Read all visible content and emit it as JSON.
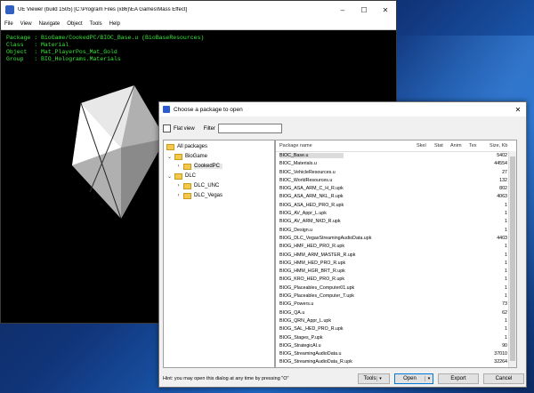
{
  "viewer": {
    "title": "UE Viewer (build 1505) [C:\\Program Files (x86)\\EA Games\\Mass Effect]",
    "menu": [
      "File",
      "View",
      "Navigate",
      "Object",
      "Tools",
      "Help"
    ],
    "console": [
      "Package : BioGame/CookedPC/BIOC_Base.u (BioBaseResources)",
      "Class   : Material",
      "Object  : Mat_PlayerPos_Mat_Gold",
      "Group   : BIO_Holograms.Materials"
    ]
  },
  "dialog": {
    "title": "Choose a package to open",
    "flat_view_label": "Flat view",
    "filter_label": "Filter",
    "filter_value": "",
    "tree": [
      {
        "label": "All packages",
        "icon": "folder-icon"
      },
      {
        "label": "BioGame",
        "icon": "folder-icon"
      },
      {
        "label": "CookedPC",
        "icon": "folder-icon"
      },
      {
        "label": "DLC",
        "icon": "folder-icon"
      },
      {
        "label": "DLC_UNC",
        "icon": "folder-icon"
      },
      {
        "label": "DLC_Vegas",
        "icon": "folder-icon"
      }
    ],
    "columns": [
      "Package name",
      "Skel",
      "Stat",
      "Anim",
      "Tex",
      "Size, Kb"
    ],
    "rows": [
      {
        "name": "BIOC_Base.u",
        "size": "5402"
      },
      {
        "name": "BIOC_Materials.u",
        "size": "44554"
      },
      {
        "name": "BIOC_VehicleResources.u",
        "size": "27"
      },
      {
        "name": "BIOC_WorldResources.u",
        "size": "132"
      },
      {
        "name": "BIOG_ASA_ARM_C_H_R.upk",
        "size": "802"
      },
      {
        "name": "BIOG_ASA_ARM_NKL_R.upk",
        "size": "4063"
      },
      {
        "name": "BIOG_ASA_HED_PRO_R.upk",
        "size": "1"
      },
      {
        "name": "BIOG_AV_Appr_L.upk",
        "size": "1"
      },
      {
        "name": "BIOG_AV_ARM_NKD_R.upk",
        "size": "1"
      },
      {
        "name": "BIOG_Design.u",
        "size": "1"
      },
      {
        "name": "BIOG_DLC_VegasStreamingAudioData.upk",
        "size": "4403"
      },
      {
        "name": "BIOG_HMF_HED_PRO_R.upk",
        "size": "1"
      },
      {
        "name": "BIOG_HMM_ARM_MASTER_R.upk",
        "size": "1"
      },
      {
        "name": "BIOG_HMM_HED_PRO_R.upk",
        "size": "1"
      },
      {
        "name": "BIOG_HMM_HGR_BRT_R.upk",
        "size": "1"
      },
      {
        "name": "BIOG_KRO_HED_PRO_R.upk",
        "size": "1"
      },
      {
        "name": "BIOG_Placeables_Computer01.upk",
        "size": "1"
      },
      {
        "name": "BIOG_Placeables_Computer_T.upk",
        "size": "1"
      },
      {
        "name": "BIOG_Powers.u",
        "size": "73"
      },
      {
        "name": "BIOG_QA.u",
        "size": "62"
      },
      {
        "name": "BIOG_QRN_Appr_L.upk",
        "size": "1"
      },
      {
        "name": "BIOG_SAL_HED_PRO_R.upk",
        "size": "1"
      },
      {
        "name": "BIOG_Stages_P.upk",
        "size": "1"
      },
      {
        "name": "BIOG_StrategicAI.u",
        "size": "90"
      },
      {
        "name": "BIOG_StreamingAudioData.u",
        "size": "37010"
      },
      {
        "name": "BIOG_StreamingAudioData_R.upk",
        "size": "32264"
      }
    ],
    "hint": "Hint: you may open this dialog at any time by pressing \"O\"",
    "buttons": {
      "tools": "Tools",
      "open": "Open",
      "export": "Export",
      "cancel": "Cancel"
    }
  }
}
